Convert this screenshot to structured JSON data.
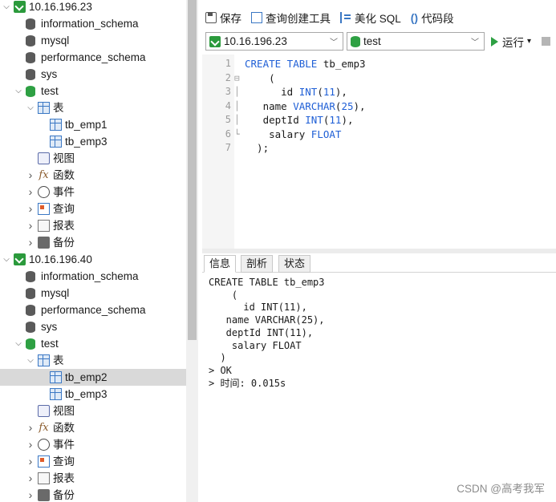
{
  "tree": [
    {
      "indent": 0,
      "arrow": "down",
      "icon": "conn",
      "label": "10.16.196.23"
    },
    {
      "indent": 1,
      "arrow": "",
      "icon": "db",
      "label": "information_schema"
    },
    {
      "indent": 1,
      "arrow": "",
      "icon": "db",
      "label": "mysql"
    },
    {
      "indent": 1,
      "arrow": "",
      "icon": "db",
      "label": "performance_schema"
    },
    {
      "indent": 1,
      "arrow": "",
      "icon": "db",
      "label": "sys"
    },
    {
      "indent": 1,
      "arrow": "down",
      "icon": "db-green",
      "label": "test"
    },
    {
      "indent": 2,
      "arrow": "down",
      "icon": "table",
      "label": "表"
    },
    {
      "indent": 3,
      "arrow": "",
      "icon": "table",
      "label": "tb_emp1"
    },
    {
      "indent": 3,
      "arrow": "",
      "icon": "table",
      "label": "tb_emp3"
    },
    {
      "indent": 2,
      "arrow": "",
      "icon": "view",
      "label": "视图"
    },
    {
      "indent": 2,
      "arrow": "right",
      "icon": "fx",
      "label": "函数"
    },
    {
      "indent": 2,
      "arrow": "right",
      "icon": "event",
      "label": "事件"
    },
    {
      "indent": 2,
      "arrow": "right",
      "icon": "query",
      "label": "查询"
    },
    {
      "indent": 2,
      "arrow": "right",
      "icon": "report",
      "label": "报表"
    },
    {
      "indent": 2,
      "arrow": "right",
      "icon": "backup",
      "label": "备份"
    },
    {
      "indent": 0,
      "arrow": "down",
      "icon": "conn",
      "label": "10.16.196.40"
    },
    {
      "indent": 1,
      "arrow": "",
      "icon": "db",
      "label": "information_schema"
    },
    {
      "indent": 1,
      "arrow": "",
      "icon": "db",
      "label": "mysql"
    },
    {
      "indent": 1,
      "arrow": "",
      "icon": "db",
      "label": "performance_schema"
    },
    {
      "indent": 1,
      "arrow": "",
      "icon": "db",
      "label": "sys"
    },
    {
      "indent": 1,
      "arrow": "down",
      "icon": "db-green",
      "label": "test"
    },
    {
      "indent": 2,
      "arrow": "down",
      "icon": "table",
      "label": "表"
    },
    {
      "indent": 3,
      "arrow": "",
      "icon": "table",
      "label": "tb_emp2",
      "selected": true
    },
    {
      "indent": 3,
      "arrow": "",
      "icon": "table",
      "label": "tb_emp3"
    },
    {
      "indent": 2,
      "arrow": "",
      "icon": "view",
      "label": "视图"
    },
    {
      "indent": 2,
      "arrow": "right",
      "icon": "fx",
      "label": "函数"
    },
    {
      "indent": 2,
      "arrow": "right",
      "icon": "event",
      "label": "事件"
    },
    {
      "indent": 2,
      "arrow": "right",
      "icon": "query",
      "label": "查询"
    },
    {
      "indent": 2,
      "arrow": "right",
      "icon": "report",
      "label": "报表"
    },
    {
      "indent": 2,
      "arrow": "right",
      "icon": "backup",
      "label": "备份"
    }
  ],
  "toolbar": {
    "save_label": "保存",
    "query_builder_label": "查询创建工具",
    "beautify_label": "美化 SQL",
    "snippet_glyph": "()",
    "snippet_label": "代码段"
  },
  "selectors": {
    "connection_value": "10.16.196.23",
    "database_value": "test",
    "run_label": "运行",
    "run_caret": "▾"
  },
  "editor": {
    "lines": [
      {
        "n": "1",
        "fold": "",
        "parts": [
          [
            "kw",
            "CREATE TABLE"
          ],
          [
            "",
            " tb_emp3"
          ]
        ]
      },
      {
        "n": "2",
        "fold": "⊟",
        "parts": [
          [
            "",
            "    ("
          ]
        ]
      },
      {
        "n": "3",
        "fold": "│",
        "parts": [
          [
            "",
            "      id "
          ],
          [
            "kw",
            "INT"
          ],
          [
            "",
            "("
          ],
          [
            "kw",
            "11"
          ],
          [
            "",
            "),"
          ]
        ]
      },
      {
        "n": "4",
        "fold": "│",
        "parts": [
          [
            "",
            "   name "
          ],
          [
            "kw",
            "VARCHAR"
          ],
          [
            "",
            "("
          ],
          [
            "kw",
            "25"
          ],
          [
            "",
            "),"
          ]
        ]
      },
      {
        "n": "5",
        "fold": "│",
        "parts": [
          [
            "",
            "   deptId "
          ],
          [
            "kw",
            "INT"
          ],
          [
            "",
            "("
          ],
          [
            "kw",
            "11"
          ],
          [
            "",
            "),"
          ]
        ]
      },
      {
        "n": "6",
        "fold": "└",
        "parts": [
          [
            "",
            "    salary "
          ],
          [
            "kw",
            "FLOAT"
          ]
        ]
      },
      {
        "n": "7",
        "fold": "",
        "parts": [
          [
            "",
            "  );"
          ]
        ]
      }
    ]
  },
  "tabs": [
    "信息",
    "剖析",
    "状态"
  ],
  "output": {
    "lines": [
      "CREATE TABLE tb_emp3",
      "    (",
      "      id INT(11),",
      "   name VARCHAR(25),",
      "   deptId INT(11),",
      "    salary FLOAT",
      "  )",
      "> OK",
      "> 时间: 0.015s"
    ]
  },
  "watermark": "CSDN @高考我军"
}
